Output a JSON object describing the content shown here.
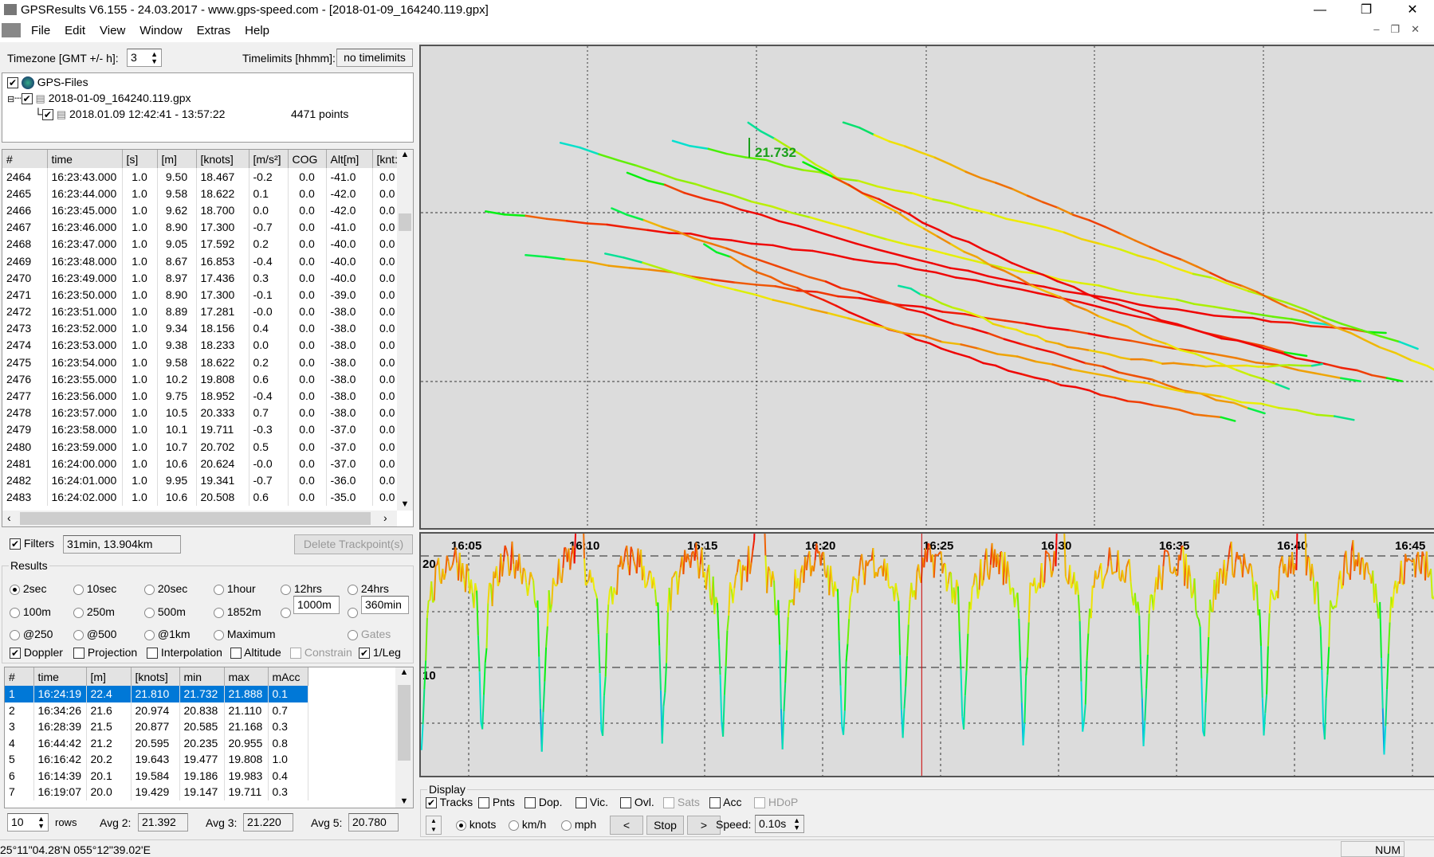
{
  "window": {
    "title": "GPSResults V6.155 - 24.03.2017 - www.gps-speed.com - [2018-01-09_164240.119.gpx]",
    "minimize": "—",
    "restore": "❐",
    "close": "✕"
  },
  "menu": [
    "File",
    "Edit",
    "View",
    "Window",
    "Extras",
    "Help"
  ],
  "toolbar": {
    "timezone_label": "Timezone [GMT +/- h]:",
    "timezone_value": "3",
    "timelimits_label": "Timelimits [hhmm]:",
    "timelimits_value": "no timelimits"
  },
  "tree": {
    "root": "GPS-Files",
    "file": "2018-01-09_164240.119.gpx",
    "segment": "2018.01.09 12:42:41 - 13:57:22",
    "points": "4471 points"
  },
  "points_table": {
    "columns": [
      "#",
      "time",
      "[s]",
      "[m]",
      "[knots]",
      "[m/s²]",
      "COG",
      "Alt[m]",
      "[knt:"
    ],
    "rows": [
      [
        "2464",
        "16:23:43.000",
        "1.0",
        "9.50",
        "18.467",
        "-0.2",
        "0.0",
        "-41.0",
        "0.0"
      ],
      [
        "2465",
        "16:23:44.000",
        "1.0",
        "9.58",
        "18.622",
        "0.1",
        "0.0",
        "-42.0",
        "0.0"
      ],
      [
        "2466",
        "16:23:45.000",
        "1.0",
        "9.62",
        "18.700",
        "0.0",
        "0.0",
        "-42.0",
        "0.0"
      ],
      [
        "2467",
        "16:23:46.000",
        "1.0",
        "8.90",
        "17.300",
        "-0.7",
        "0.0",
        "-41.0",
        "0.0"
      ],
      [
        "2468",
        "16:23:47.000",
        "1.0",
        "9.05",
        "17.592",
        "0.2",
        "0.0",
        "-40.0",
        "0.0"
      ],
      [
        "2469",
        "16:23:48.000",
        "1.0",
        "8.67",
        "16.853",
        "-0.4",
        "0.0",
        "-40.0",
        "0.0"
      ],
      [
        "2470",
        "16:23:49.000",
        "1.0",
        "8.97",
        "17.436",
        "0.3",
        "0.0",
        "-40.0",
        "0.0"
      ],
      [
        "2471",
        "16:23:50.000",
        "1.0",
        "8.90",
        "17.300",
        "-0.1",
        "0.0",
        "-39.0",
        "0.0"
      ],
      [
        "2472",
        "16:23:51.000",
        "1.0",
        "8.89",
        "17.281",
        "-0.0",
        "0.0",
        "-38.0",
        "0.0"
      ],
      [
        "2473",
        "16:23:52.000",
        "1.0",
        "9.34",
        "18.156",
        "0.4",
        "0.0",
        "-38.0",
        "0.0"
      ],
      [
        "2474",
        "16:23:53.000",
        "1.0",
        "9.38",
        "18.233",
        "0.0",
        "0.0",
        "-38.0",
        "0.0"
      ],
      [
        "2475",
        "16:23:54.000",
        "1.0",
        "9.58",
        "18.622",
        "0.2",
        "0.0",
        "-38.0",
        "0.0"
      ],
      [
        "2476",
        "16:23:55.000",
        "1.0",
        "10.2",
        "19.808",
        "0.6",
        "0.0",
        "-38.0",
        "0.0"
      ],
      [
        "2477",
        "16:23:56.000",
        "1.0",
        "9.75",
        "18.952",
        "-0.4",
        "0.0",
        "-38.0",
        "0.0"
      ],
      [
        "2478",
        "16:23:57.000",
        "1.0",
        "10.5",
        "20.333",
        "0.7",
        "0.0",
        "-38.0",
        "0.0"
      ],
      [
        "2479",
        "16:23:58.000",
        "1.0",
        "10.1",
        "19.711",
        "-0.3",
        "0.0",
        "-37.0",
        "0.0"
      ],
      [
        "2480",
        "16:23:59.000",
        "1.0",
        "10.7",
        "20.702",
        "0.5",
        "0.0",
        "-37.0",
        "0.0"
      ],
      [
        "2481",
        "16:24:00.000",
        "1.0",
        "10.6",
        "20.624",
        "-0.0",
        "0.0",
        "-37.0",
        "0.0"
      ],
      [
        "2482",
        "16:24:01.000",
        "1.0",
        "9.95",
        "19.341",
        "-0.7",
        "0.0",
        "-36.0",
        "0.0"
      ],
      [
        "2483",
        "16:24:02.000",
        "1.0",
        "10.6",
        "20.508",
        "0.6",
        "0.0",
        "-35.0",
        "0.0"
      ]
    ]
  },
  "filters": {
    "label": "Filters",
    "checked": true,
    "value": "31min, 13.904km",
    "delete_button": "Delete Trackpoint(s)"
  },
  "results": {
    "title": "Results",
    "radios": [
      [
        "2sec",
        "10sec",
        "20sec",
        "1hour",
        "12hrs",
        "24hrs"
      ],
      [
        "100m",
        "250m",
        "500m",
        "1852m",
        "",
        ""
      ],
      [
        "@250",
        "@500",
        "@1km",
        "Maximum"
      ]
    ],
    "selected": "2sec",
    "custom_distance": "1000m",
    "custom_time": "360min",
    "gates": "Gates",
    "checks": [
      {
        "label": "Doppler",
        "checked": true
      },
      {
        "label": "Projection",
        "checked": false
      },
      {
        "label": "Interpolation",
        "checked": false
      },
      {
        "label": "Altitude",
        "checked": false
      },
      {
        "label": "Constrain",
        "checked": false,
        "disabled": true
      },
      {
        "label": "1/Leg",
        "checked": true
      }
    ],
    "columns": [
      "#",
      "time",
      "[m]",
      "[knots]",
      "min",
      "max",
      "mAcc"
    ],
    "rows": [
      [
        "1",
        "16:24:19",
        "22.4",
        "21.810",
        "21.732",
        "21.888",
        "0.1"
      ],
      [
        "2",
        "16:34:26",
        "21.6",
        "20.974",
        "20.838",
        "21.110",
        "0.7"
      ],
      [
        "3",
        "16:28:39",
        "21.5",
        "20.877",
        "20.585",
        "21.168",
        "0.3"
      ],
      [
        "4",
        "16:44:42",
        "21.2",
        "20.595",
        "20.235",
        "20.955",
        "0.8"
      ],
      [
        "5",
        "16:16:42",
        "20.2",
        "19.643",
        "19.477",
        "19.808",
        "1.0"
      ],
      [
        "6",
        "16:14:39",
        "20.1",
        "19.584",
        "19.186",
        "19.983",
        "0.4"
      ],
      [
        "7",
        "16:19:07",
        "20.0",
        "19.429",
        "19.147",
        "19.711",
        "0.3"
      ]
    ],
    "rows_count": "10",
    "rows_label": "rows",
    "avg2_label": "Avg 2:",
    "avg2": "21.392",
    "avg3_label": "Avg 3:",
    "avg3": "21.220",
    "avg5_label": "Avg 5:",
    "avg5": "20.780"
  },
  "map": {
    "max_label": "21.732",
    "colors": {
      "slow": "#1a6fe0",
      "mid": "#22e022",
      "fast": "#ff3000"
    }
  },
  "speed_chart": {
    "x_ticks": [
      "16:05",
      "16:10",
      "16:15",
      "16:20",
      "16:25",
      "16:30",
      "16:35",
      "16:40",
      "16:45"
    ],
    "y_ticks": [
      "20",
      "10"
    ]
  },
  "display": {
    "title": "Display",
    "checks": [
      {
        "label": "Tracks",
        "checked": true
      },
      {
        "label": "Pnts",
        "checked": false
      },
      {
        "label": "Dop.",
        "checked": false
      },
      {
        "label": "Vic.",
        "checked": false
      },
      {
        "label": "Ovl.",
        "checked": false
      },
      {
        "label": "Sats",
        "checked": false,
        "disabled": true
      },
      {
        "label": "Acc",
        "checked": false
      },
      {
        "label": "HDoP",
        "checked": false,
        "disabled": true
      }
    ],
    "units": [
      "knots",
      "km/h",
      "mph"
    ],
    "selected_unit": "knots",
    "prev": "<",
    "stop": "Stop",
    "next": ">",
    "speed_label": "Speed:",
    "speed_value": "0.10s"
  },
  "status": {
    "coords": "25°11\"04.28'N 055°12\"39.02'E",
    "num": "NUM"
  }
}
